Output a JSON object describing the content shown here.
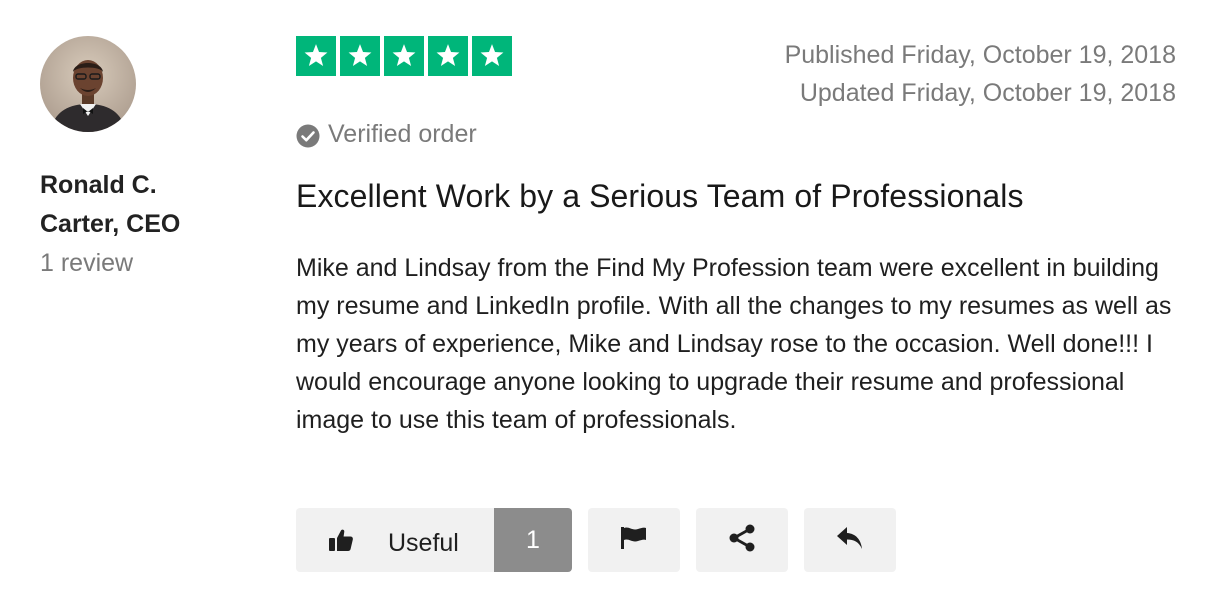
{
  "reviewer": {
    "name": "Ronald C. Carter, CEO",
    "review_count": "1 review"
  },
  "rating": {
    "stars": 5,
    "max_stars": 5,
    "star_color": "#00b67a"
  },
  "dates": {
    "published": "Published Friday, October 19, 2018",
    "updated": "Updated Friday, October 19, 2018"
  },
  "verified": {
    "label": "Verified order",
    "icon": "check-circle-icon"
  },
  "review": {
    "title": "Excellent Work by a Serious Team of Professionals",
    "body": "Mike and Lindsay from the Find My Profession team were excellent in building my resume and LinkedIn profile. With all the changes to my resumes as well as my years of experience, Mike and Lindsay rose to the occasion. Well done!!! I would encourage anyone looking to upgrade their resume and professional image to use this team of professionals."
  },
  "actions": {
    "useful_label": "Useful",
    "useful_count": "1",
    "useful_icon": "thumbs-up-icon",
    "flag_icon": "flag-icon",
    "share_icon": "share-icon",
    "reply_icon": "reply-icon"
  }
}
